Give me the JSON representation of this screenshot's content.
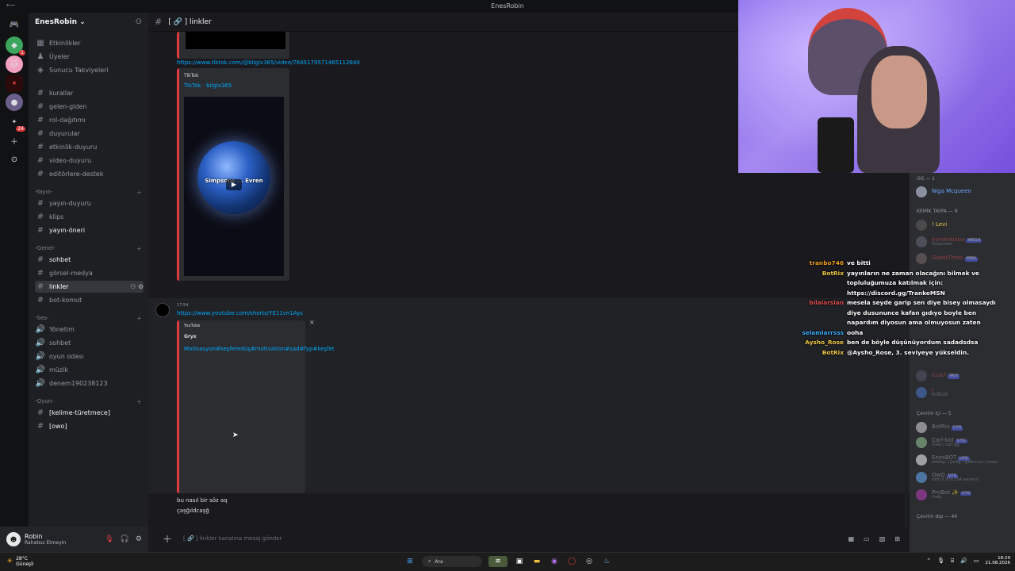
{
  "window": {
    "title": "EnesRobin"
  },
  "server_rail": {
    "items": [
      "discord-home",
      "server-1",
      "server-2",
      "server-3",
      "server-4",
      "server-5",
      "add-server",
      "discover"
    ],
    "badges": [
      "1",
      "24"
    ]
  },
  "sidebar": {
    "server_name": "EnesRobin ⌄",
    "top_items": [
      {
        "icon": "calendar-icon",
        "label": "Etkinlikler"
      },
      {
        "icon": "users-icon",
        "label": "Üyeler"
      },
      {
        "icon": "boost-icon",
        "label": "Sunucu Takviyeleri"
      }
    ],
    "info_channels": [
      "kurallar",
      "gelen-giden",
      "rol-dağıtımı",
      "duyurular",
      "etkinlik-duyuru",
      "video-duyuru",
      "editörlere-destek"
    ],
    "cat_yayin": "-Yayın-",
    "yayin_channels": [
      "yayın-duyuru",
      "klips",
      "yayın-öneri"
    ],
    "cat_genel": "-Genel-",
    "genel_channels": [
      "sohbet",
      "görsel-medya",
      "linkler",
      "bot-komut"
    ],
    "cat_ses": "-Ses-",
    "ses_channels": [
      "Yönetim",
      "sohbet",
      "oyun odası",
      "müzik",
      "denem190238123"
    ],
    "cat_oyun": "-Oyun-",
    "oyun_channels": [
      "[kelime-türetmece]",
      "[owo]"
    ]
  },
  "user_panel": {
    "name": "Robin",
    "status": "Rahatsız Etmeyin"
  },
  "channel_header": {
    "name": "[ 🔗 ] linkler"
  },
  "messages": {
    "tiktok_link": "https://www.tiktok.com/@bilgix365/video/7645179571465112840",
    "tiktok_provider": "TikTok",
    "tiktok_title": "TikTok · bilgix365",
    "tiktok_overlay": "Simpsons ... Evren",
    "timestamp": "17:54",
    "yt_link": "https://www.youtube.com/shorts/YE11vn1Ays",
    "yt_provider": "YouTube",
    "yt_author": "Gryx",
    "yt_title": "Motivasyon#keşfetedüş#motivation#sad#fyp#keşfet",
    "msg1": "bu nasıl bir söz aq",
    "msg2": "çaşğıldcaşğ"
  },
  "composer": {
    "placeholder": "[ 🔗 ] linkler kanalına mesaj gönder"
  },
  "members": {
    "cat_og": "OG — 1",
    "og": [
      {
        "name": "Niga Mcqueen",
        "color": "#6ea8ff"
      }
    ],
    "cat_kemik": "KEMİK TAYFA — 6",
    "kemik": [
      {
        "name": "! Levi",
        "color": "#f0c94a",
        "sub": ""
      },
      {
        "name": "eymenbaba",
        "color": "#e05050",
        "tag": "WEGH",
        "sub": "TLauncher"
      },
      {
        "name": "GuestTmes",
        "color": "#e05050",
        "tag": "MİRA",
        "sub": ""
      },
      {
        "name": "lcus7",
        "color": "#e05050",
        "tag": "RKH",
        "sub": ""
      },
      {
        "name": "r",
        "color": "#e05050",
        "sub": "ROBLOX"
      }
    ],
    "cat_online": "Çevrim içi — 5",
    "online": [
      {
        "name": "BotRix",
        "color": "#5865f2",
        "tag": "UYG",
        "sub": ""
      },
      {
        "name": "Carl-bot",
        "color": "#5865f2",
        "tag": "UYG",
        "sub": "/help | carl.gg"
      },
      {
        "name": "EnesBOT",
        "color": "#5865f2",
        "tag": "UYG",
        "sub": "etkileşi | Çelliğ - gafmcum | ekanı"
      },
      {
        "name": "OwO",
        "color": "#5865f2",
        "tag": "UYG",
        "sub": "with 5,970,154 servers!"
      },
      {
        "name": "ProBot ✨",
        "color": "#5865f2",
        "tag": "UYG",
        "sub": "/help"
      }
    ],
    "cat_offline": "Çevrim dışı — 44"
  },
  "stream_chat": [
    {
      "user": "tranbo746",
      "color": "#f0a020",
      "text": "ve bitti"
    },
    {
      "user": "BotRix",
      "color": "#f0c94a",
      "text": "yayınların ne zaman olacağını bilmek ve topluluğumuza katılmak için: https://discord.gg/TrankeMSN"
    },
    {
      "user": "bilalarslan",
      "color": "#e05050",
      "text": "mesela seyde garip sen diye bisey olmasaydı diye dusununce kafan gıdıyo boyle ben napardım diyosun ama olmuyosun zaten"
    },
    {
      "user": "selamlarrsss",
      "color": "#3ab0ff",
      "text": "ooha"
    },
    {
      "user": "Aysho_Rose",
      "color": "#f0c94a",
      "text": "ben de böyle düşünüyordum sadadsdsa"
    },
    {
      "user": "BotRix",
      "color": "#f0c94a",
      "text": "@Aysho_Rose, 3. seviyeye yükseldin."
    }
  ],
  "taskbar": {
    "weather_temp": "28°C",
    "weather_desc": "Güneşli",
    "search_label": "Ara",
    "time": "18:29",
    "date": "21.08.2026"
  }
}
